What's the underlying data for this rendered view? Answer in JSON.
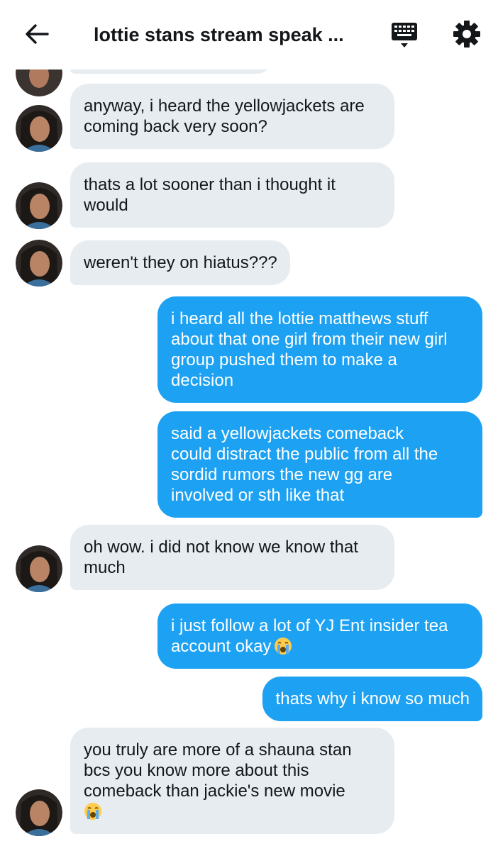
{
  "header": {
    "title": "lottie stans stream speak ...",
    "back_icon": "arrow-left-icon",
    "keyboard_icon": "keyboard-icon",
    "settings_icon": "gear-icon"
  },
  "colors": {
    "incoming_bubble": "#e6ecf0",
    "outgoing_bubble": "#1da1f2",
    "text": "#14171a"
  },
  "messages": [
    {
      "side": "in",
      "text": "anyway, i heard the yellowjackets are\ncoming back very soon?"
    },
    {
      "side": "in",
      "text": "thats a lot sooner than i thought it\nwould"
    },
    {
      "side": "in",
      "text": "weren't they on hiatus???"
    },
    {
      "side": "out",
      "text": "i heard all the lottie matthews stuff\nabout that one girl from their new girl\ngroup pushed them to make a\ndecision"
    },
    {
      "side": "out",
      "text": "said a yellowjackets comeback\ncould distract the public from all the\nsordid rumors the new gg are\ninvolved or sth like that"
    },
    {
      "side": "in",
      "text": "oh wow. i did not know we know that\nmuch"
    },
    {
      "side": "out",
      "text": "i just follow a lot of YJ Ent insider tea\naccount okay",
      "emoji": "loudly-crying-face"
    },
    {
      "side": "out",
      "text": "thats why i know so much"
    },
    {
      "side": "in",
      "text": "you truly are more of a shauna stan\nbcs you know more about this\ncomeback than jackie's new movie",
      "emoji": "loudly-crying-face"
    }
  ]
}
